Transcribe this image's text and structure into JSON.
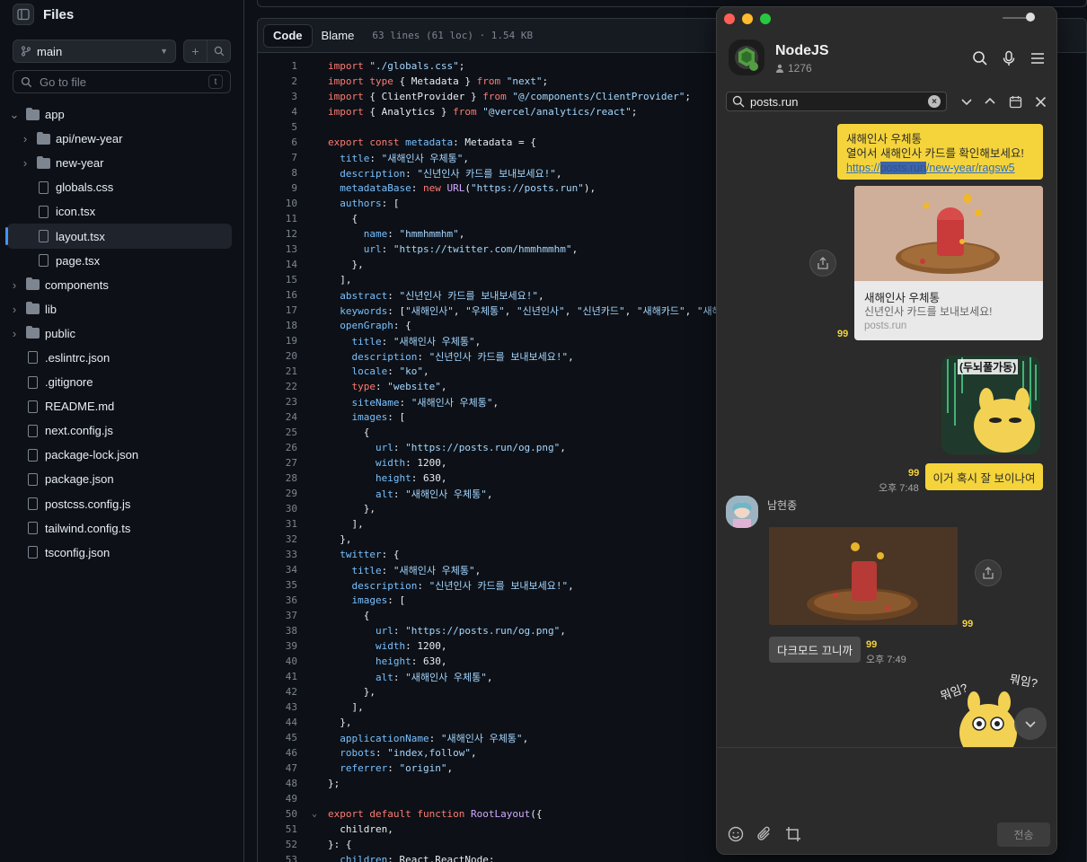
{
  "sidebar": {
    "title": "Files",
    "branch": "main",
    "goto_placeholder": "Go to file",
    "goto_shortcut": "t",
    "tree": [
      {
        "label": "app",
        "type": "folder",
        "depth": 0,
        "expanded": true
      },
      {
        "label": "api/new-year",
        "type": "folder",
        "depth": 1,
        "expanded": false
      },
      {
        "label": "new-year",
        "type": "folder",
        "depth": 1,
        "expanded": false
      },
      {
        "label": "globals.css",
        "type": "file",
        "depth": 1
      },
      {
        "label": "icon.tsx",
        "type": "file",
        "depth": 1
      },
      {
        "label": "layout.tsx",
        "type": "file",
        "depth": 1,
        "selected": true
      },
      {
        "label": "page.tsx",
        "type": "file",
        "depth": 1
      },
      {
        "label": "components",
        "type": "folder",
        "depth": 0,
        "expanded": false
      },
      {
        "label": "lib",
        "type": "folder",
        "depth": 0,
        "expanded": false
      },
      {
        "label": "public",
        "type": "folder",
        "depth": 0,
        "expanded": false
      },
      {
        "label": ".eslintrc.json",
        "type": "file",
        "depth": 0
      },
      {
        "label": ".gitignore",
        "type": "file",
        "depth": 0
      },
      {
        "label": "README.md",
        "type": "file",
        "depth": 0
      },
      {
        "label": "next.config.js",
        "type": "file",
        "depth": 0
      },
      {
        "label": "package-lock.json",
        "type": "file",
        "depth": 0
      },
      {
        "label": "package.json",
        "type": "file",
        "depth": 0
      },
      {
        "label": "postcss.config.js",
        "type": "file",
        "depth": 0
      },
      {
        "label": "tailwind.config.ts",
        "type": "file",
        "depth": 0
      },
      {
        "label": "tsconfig.json",
        "type": "file",
        "depth": 0
      }
    ]
  },
  "code": {
    "tabs": [
      "Code",
      "Blame"
    ],
    "active_tab": "Code",
    "meta": "63 lines (61 loc) · 1.54 KB",
    "lines": [
      {
        "n": 1,
        "text": "import \"./globals.css\";"
      },
      {
        "n": 2,
        "text": "import type { Metadata } from \"next\";"
      },
      {
        "n": 3,
        "text": "import { ClientProvider } from \"@/components/ClientProvider\";"
      },
      {
        "n": 4,
        "text": "import { Analytics } from \"@vercel/analytics/react\";"
      },
      {
        "n": 5,
        "text": ""
      },
      {
        "n": 6,
        "text": "export const metadata: Metadata = {"
      },
      {
        "n": 7,
        "text": "  title: \"새해인사 우체통\","
      },
      {
        "n": 8,
        "text": "  description: \"신년인사 카드를 보내보세요!\","
      },
      {
        "n": 9,
        "text": "  metadataBase: new URL(\"https://posts.run\"),"
      },
      {
        "n": 10,
        "text": "  authors: ["
      },
      {
        "n": 11,
        "text": "    {"
      },
      {
        "n": 12,
        "text": "      name: \"hmmhmmhm\","
      },
      {
        "n": 13,
        "text": "      url: \"https://twitter.com/hmmhmmhm\","
      },
      {
        "n": 14,
        "text": "    },"
      },
      {
        "n": 15,
        "text": "  ],"
      },
      {
        "n": 16,
        "text": "  abstract: \"신년인사 카드를 보내보세요!\","
      },
      {
        "n": 17,
        "text": "  keywords: [\"새해인사\", \"우체통\", \"신년인사\", \"신년카드\", \"새해카드\", \"새해\"],"
      },
      {
        "n": 18,
        "text": "  openGraph: {"
      },
      {
        "n": 19,
        "text": "    title: \"새해인사 우체통\","
      },
      {
        "n": 20,
        "text": "    description: \"신년인사 카드를 보내보세요!\","
      },
      {
        "n": 21,
        "text": "    locale: \"ko\","
      },
      {
        "n": 22,
        "text": "    type: \"website\","
      },
      {
        "n": 23,
        "text": "    siteName: \"새해인사 우체통\","
      },
      {
        "n": 24,
        "text": "    images: ["
      },
      {
        "n": 25,
        "text": "      {"
      },
      {
        "n": 26,
        "text": "        url: \"https://posts.run/og.png\","
      },
      {
        "n": 27,
        "text": "        width: 1200,"
      },
      {
        "n": 28,
        "text": "        height: 630,"
      },
      {
        "n": 29,
        "text": "        alt: \"새해인사 우체통\","
      },
      {
        "n": 30,
        "text": "      },"
      },
      {
        "n": 31,
        "text": "    ],"
      },
      {
        "n": 32,
        "text": "  },"
      },
      {
        "n": 33,
        "text": "  twitter: {"
      },
      {
        "n": 34,
        "text": "    title: \"새해인사 우체통\","
      },
      {
        "n": 35,
        "text": "    description: \"신년인사 카드를 보내보세요!\","
      },
      {
        "n": 36,
        "text": "    images: ["
      },
      {
        "n": 37,
        "text": "      {"
      },
      {
        "n": 38,
        "text": "        url: \"https://posts.run/og.png\","
      },
      {
        "n": 39,
        "text": "        width: 1200,"
      },
      {
        "n": 40,
        "text": "        height: 630,"
      },
      {
        "n": 41,
        "text": "        alt: \"새해인사 우체통\","
      },
      {
        "n": 42,
        "text": "      },"
      },
      {
        "n": 43,
        "text": "    ],"
      },
      {
        "n": 44,
        "text": "  },"
      },
      {
        "n": 45,
        "text": "  applicationName: \"새해인사 우체통\","
      },
      {
        "n": 46,
        "text": "  robots: \"index,follow\","
      },
      {
        "n": 47,
        "text": "  referrer: \"origin\","
      },
      {
        "n": 48,
        "text": "};"
      },
      {
        "n": 49,
        "text": ""
      },
      {
        "n": 50,
        "text": "export default function RootLayout({",
        "fold": true
      },
      {
        "n": 51,
        "text": "  children,"
      },
      {
        "n": 52,
        "text": "}: {"
      },
      {
        "n": 53,
        "text": "  children: React.ReactNode;"
      }
    ]
  },
  "chat": {
    "room_name": "NodeJS",
    "member_count": "1276",
    "search_query": "posts.run",
    "messages": {
      "m1_title": "새해인사 우체통",
      "m1_body": "열어서 새해인사 카드를 확인해보세요!",
      "m1_link_pre": "https://",
      "m1_link_hl": "posts.run",
      "m1_link_post": "/new-year/ragsw5",
      "card_title": "새해인사 우체통",
      "card_desc": "신년인사 카드를 보내보세요!",
      "card_domain": "posts.run",
      "unread_1": "99",
      "sticker_text": "(두뇌풀가동)",
      "unread_2": "99",
      "time_1": "오후 7:48",
      "m2_text": "이거 혹시 잘 보이나여",
      "sender": "남현종",
      "unread_3": "99",
      "m3_text": "다크모드 끄니까",
      "unread_4": "99",
      "time_2": "오후 7:49",
      "sticker2_text_a": "뭐임?",
      "sticker2_text_b": "뭐임?"
    },
    "send_label": "전송"
  },
  "colors": {
    "accent_blue": "#4493f8",
    "chat_yellow": "#f5d43b",
    "chat_bg": "#2b2b2b"
  }
}
